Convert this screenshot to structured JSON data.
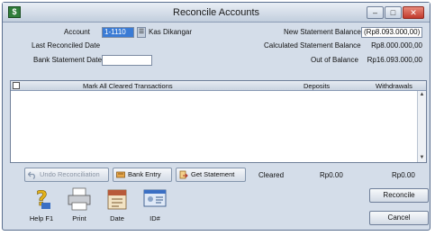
{
  "window": {
    "title": "Reconcile Accounts",
    "icon": "app-icon"
  },
  "header": {
    "account_label": "Account",
    "account_value": "1-1110",
    "account_name": "Kas Dikangar",
    "last_reconciled_label": "Last Reconciled Date",
    "last_reconciled_value": "",
    "bank_statement_date_label": "Bank Statement Date",
    "bank_statement_date_value": "",
    "new_statement_balance_label": "New Statement Balance",
    "new_statement_balance_value": "(Rp8.093.000,00)",
    "calculated_statement_balance_label": "Calculated Statement Balance",
    "calculated_statement_balance_value": "Rp8.000.000,00",
    "out_of_balance_label": "Out of Balance",
    "out_of_balance_value": "Rp16.093.000,00"
  },
  "grid": {
    "columns": {
      "mark_all": "Mark All Cleared Transactions",
      "deposits": "Deposits",
      "withdrawals": "Withdrawals"
    },
    "rows": []
  },
  "toolbar": {
    "undo_reconciliation": "Undo Reconciliation",
    "bank_entry": "Bank Entry",
    "get_statement": "Get Statement"
  },
  "totals": {
    "cleared_label": "Cleared",
    "deposits_total": "Rp0.00",
    "withdrawals_total": "Rp0.00"
  },
  "bottom_buttons": {
    "help": "Help F1",
    "print": "Print",
    "date": "Date",
    "id": "ID#"
  },
  "actions": {
    "reconcile": "Reconcile",
    "cancel": "Cancel"
  }
}
